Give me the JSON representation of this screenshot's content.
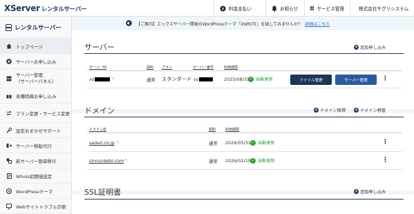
{
  "topbar": {
    "logo_main": "XServer",
    "logo_sub": "レンタルサーバー",
    "nav": [
      {
        "label": "料金支払い",
        "icon": "yen-icon"
      },
      {
        "label": "お知らせ",
        "icon": "bell-icon"
      },
      {
        "label": "サービス管理",
        "icon": "grid-icon"
      },
      {
        "label": "株式会社サグリシステム",
        "icon": "user-icon"
      }
    ]
  },
  "sidebar": {
    "title": "レンタルサーバー",
    "items": [
      {
        "label": "トップページ",
        "icon": "home-icon",
        "active": true
      },
      {
        "label": "サーバーお申し込み",
        "icon": "plus-circle-icon"
      },
      {
        "label": "サーバー管理",
        "label2": "（サーバーパネル）",
        "icon": "server-icon"
      },
      {
        "label": "各種特典お申し込み",
        "icon": "gift-icon"
      },
      {
        "label": "プラン変更・サービス変更",
        "icon": "swap-icon"
      },
      {
        "label": "設定おまかせサポート",
        "icon": "tools-icon"
      },
      {
        "label": "サーバー移転代行",
        "icon": "transfer-icon"
      },
      {
        "label": "新サーバー簡単移行",
        "icon": "migrate-icon"
      },
      {
        "label": "Whois初期値設定",
        "icon": "doc-icon"
      },
      {
        "label": "WordPressテーマ",
        "icon": "wordpress-icon"
      },
      {
        "label": "Webサイトトラブル診断",
        "icon": "diagnose-icon"
      }
    ]
  },
  "notice": {
    "text": "【ご案内】エックスサーバー開発のWordPressテーマ「XWRITE」を試してみませんか？",
    "link": "詳細はこちら"
  },
  "server": {
    "title": "サーバー",
    "add_label": "追加申し込み",
    "headers": {
      "id": "サーバーID",
      "contract": "契約",
      "plan": "プラン",
      "number": "サーバー番号",
      "expiry": "利用期限"
    },
    "row": {
      "id": "xs",
      "contract": "通常",
      "plan": "スタンダード",
      "number": "sv",
      "expiry": "2025/08/31",
      "status": "自動更新",
      "file_btn": "ファイル管理",
      "server_btn": "サーバー管理"
    }
  },
  "domain": {
    "title": "ドメイン",
    "acquire_label": "ドメイン取得",
    "transfer_label": "ドメイン移管",
    "headers": {
      "name": "ドメイン名",
      "contract": "契約",
      "expiry": "利用期限"
    },
    "rows": [
      {
        "name": "sadari.co.jp",
        "contract": "通常",
        "expiry": "2026/05/31",
        "status": "自動更新"
      },
      {
        "name": "zinnunkebi.com",
        "contract": "通常",
        "expiry": "2026/02/19",
        "status": "自動更新"
      }
    ]
  },
  "ssl": {
    "title": "SSL証明書",
    "add_label": "追加申し込み"
  },
  "colors": {
    "navy": "#1d3557",
    "green": "#2e9e3e",
    "link": "#2a6fba"
  }
}
